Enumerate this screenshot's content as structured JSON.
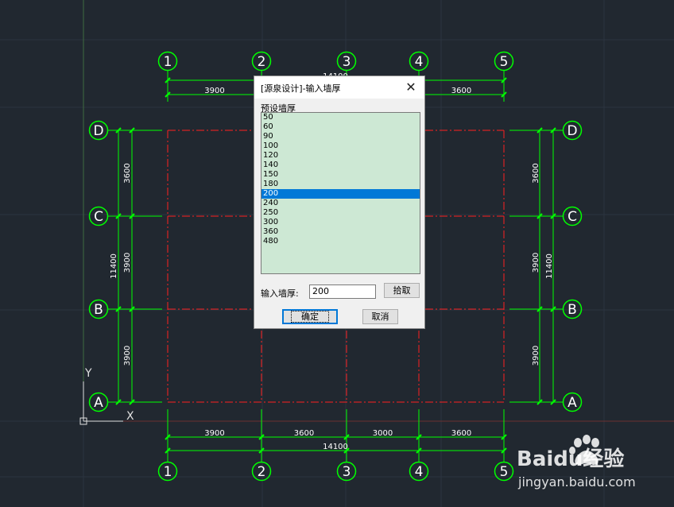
{
  "drawing": {
    "column_labels": [
      "1",
      "2",
      "3",
      "4",
      "5"
    ],
    "row_labels": [
      "D",
      "C",
      "B",
      "A"
    ],
    "top_bay_dims": [
      "3900",
      "3600"
    ],
    "top_overall_dim": "14100",
    "bottom_bay_dims": [
      "3900",
      "3600",
      "3000",
      "3600"
    ],
    "bottom_overall_dim": "14100",
    "left_bay_dims": [
      "3600",
      "3900",
      "3900"
    ],
    "left_overall_dim": "11400",
    "right_bay_dims": [
      "3600",
      "3900",
      "3900"
    ],
    "right_overall_dim": "11400",
    "ucs_x_label": "X",
    "ucs_y_label": "Y",
    "colors": {
      "background": "#212830",
      "dimension": "#00ff00",
      "axis": "#ff2020",
      "grid": "#2c3440"
    }
  },
  "dialog": {
    "title": "[源泉设计]-输入墙厚",
    "close_icon": "close-icon",
    "preset_label": "预设墙厚",
    "preset_values": [
      "50",
      "60",
      "90",
      "100",
      "120",
      "140",
      "150",
      "180",
      "200",
      "240",
      "250",
      "300",
      "360",
      "480"
    ],
    "selected_value": "200",
    "input_label": "输入墙厚:",
    "input_value": "200",
    "pick_button": "拾取",
    "ok_button": "确定",
    "cancel_button": "取消"
  },
  "watermark": {
    "brand": "Baidu经验",
    "url": "jingyan.baidu.com"
  }
}
